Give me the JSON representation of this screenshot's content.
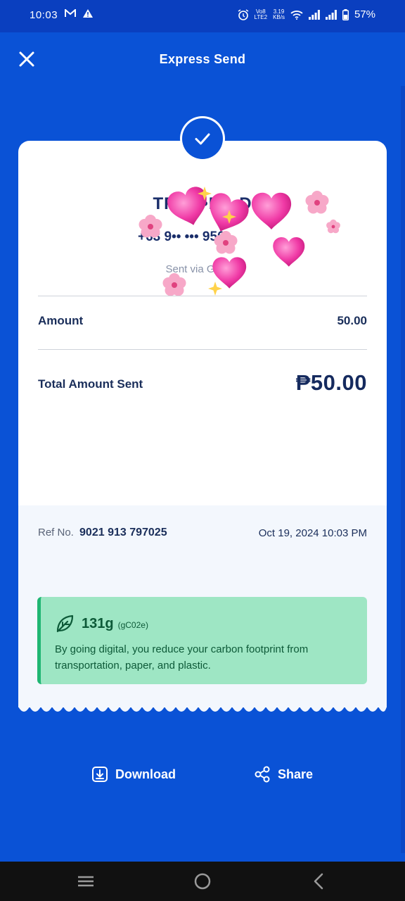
{
  "status_bar": {
    "time": "10:03",
    "volte_label": "Vo8",
    "lte_label": "LTE2",
    "speed_value": "3.19",
    "speed_unit": "KB/s",
    "battery": "57%"
  },
  "header": {
    "title": "Express Send"
  },
  "recipient": {
    "name_masked": "TR••   ••E  ••D",
    "number_masked": "+63 9•• ••• 956",
    "via": "Sent via GCash"
  },
  "details": {
    "amount_label": "Amount",
    "amount_value": "50.00",
    "total_label": "Total Amount Sent",
    "total_value": "₱50.00"
  },
  "reference": {
    "ref_label": "Ref No.",
    "ref_number": "9021 913 797025",
    "datetime": "Oct 19, 2024 10:03 PM"
  },
  "eco": {
    "value": "131g",
    "unit": "(gC02e)",
    "message": "By going digital, you reduce your carbon footprint from transportation, paper, and plastic."
  },
  "actions": {
    "download": "Download",
    "share": "Share"
  },
  "colors": {
    "brand_blue": "#0a52d6",
    "eco_green": "#9ee6c4",
    "eco_accent": "#1fb673",
    "text_navy": "#1a2e5a"
  }
}
